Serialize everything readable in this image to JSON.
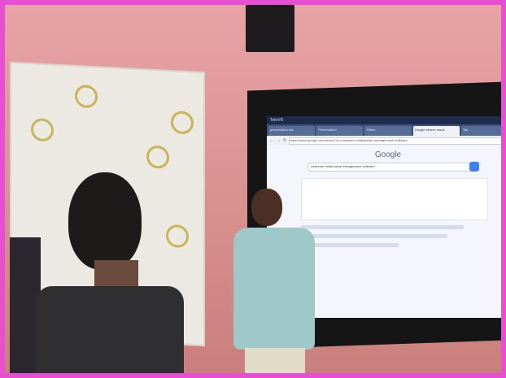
{
  "photo": {
    "screen": {
      "taskbar_title": "TeleVR",
      "tabs": [
        "presentation tab",
        "Presentation",
        "Slides",
        "Google search result",
        "Tab"
      ],
      "address_bar": "https://www.google.com/search?q=customer+relationship+management+software",
      "search_engine": "Google",
      "search_query": "customer relationship management software"
    }
  }
}
